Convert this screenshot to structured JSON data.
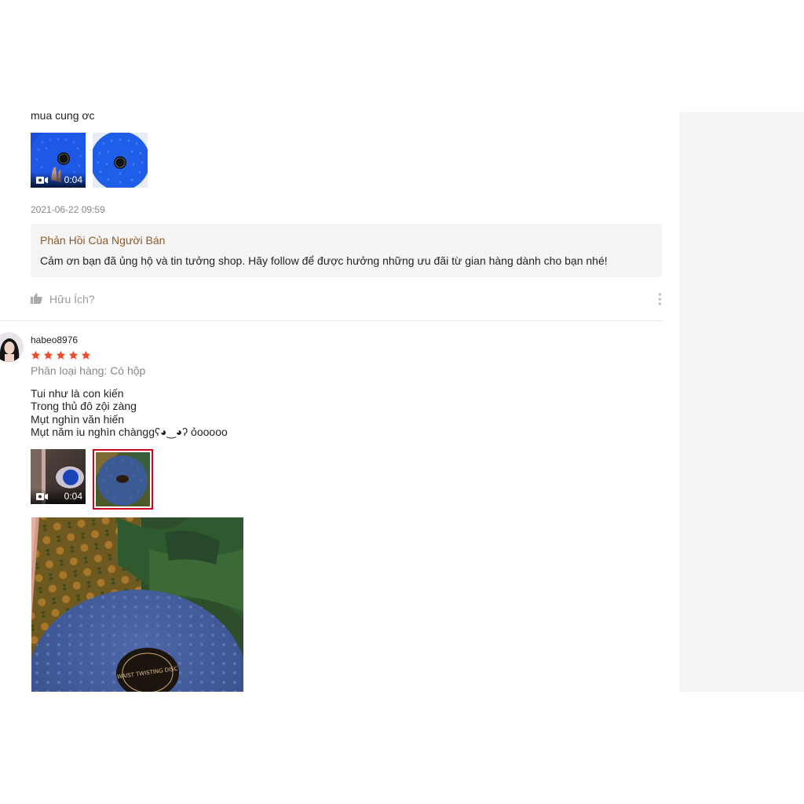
{
  "review1": {
    "text": "mua cung ơc",
    "media": [
      {
        "type": "video",
        "duration": "0:04"
      },
      {
        "type": "image"
      }
    ],
    "timestamp": "2021-06-22 09:59",
    "seller_reply": {
      "title": "Phản Hồi Của Người Bán",
      "message": "Cảm ơn bạn đã ủng hộ và tin tưởng shop. Hãy follow để được hưởng những ưu đãi từ gian hàng dành cho bạn nhé!"
    },
    "helpful_label": "Hữu Ích?"
  },
  "review2": {
    "username": "habeo8976",
    "rating": 5,
    "variation": "Phân loại hàng: Có hộp",
    "lines": [
      "Tui như là con kiến",
      "Trong thủ đô zội zàng",
      "Mụt nghìn văn hiến",
      "Mụt năm iu nghìn chànggʕ◕‿◕ʔ ỏooooo"
    ],
    "media": [
      {
        "type": "video",
        "duration": "0:04"
      },
      {
        "type": "image",
        "selected": true
      }
    ],
    "photo_label": "WAIST TWISTING DISC"
  },
  "colors": {
    "accent": "#d0011b",
    "star": "#ee4d2d",
    "seller_title": "#8b5a2b",
    "muted": "#888888",
    "sidebar": "#f5f5f5"
  },
  "icons": {
    "video": "video-camera-icon",
    "helpful": "thumbs-up-icon",
    "more": "more-vertical-icon",
    "star": "star-icon"
  }
}
